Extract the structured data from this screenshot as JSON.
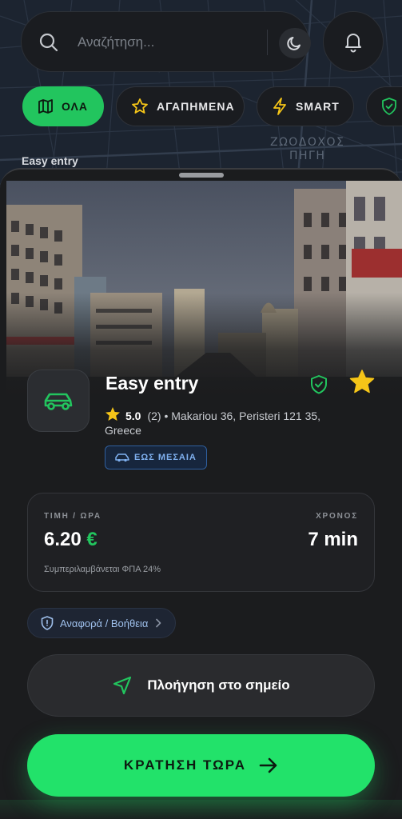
{
  "search": {
    "placeholder": "Αναζήτηση..."
  },
  "map": {
    "district_label_line1": "ΖΩΟΔΟΧΟΣ",
    "district_label_line2": "ΠΗΓΗ"
  },
  "filters": [
    {
      "label": "ΟΛΑ",
      "icon": "map-icon",
      "active": true
    },
    {
      "label": "ΑΓΑΠΗΜΕΝΑ",
      "icon": "star-outline-icon",
      "active": false
    },
    {
      "label": "SMART",
      "icon": "lightning-icon",
      "active": false
    }
  ],
  "map_pin_label": "Easy entry",
  "spot": {
    "title": "Easy entry",
    "rating": "5.0",
    "reviews_and_address": "(2) • Makariou 36, Peristeri 121 35, Greece",
    "size_badge": "ΕΩΣ ΜΕΣΑΙΑ"
  },
  "price_card": {
    "price_label": "ΤΙΜΗ / ΩΡΑ",
    "price_value": "6.20",
    "currency": "€",
    "time_label": "ΧΡΟΝΟΣ",
    "time_value": "7 min",
    "vat_note": "Συμπεριλαμβάνεται ΦΠΑ 24%"
  },
  "actions": {
    "report_label": "Αναφορά / Βοήθεια",
    "navigate_label": "Πλοήγηση στο σημείο",
    "book_label": "ΚΡΑΤΗΣΗ ΤΩΡΑ"
  },
  "colors": {
    "accent": "#22c55e",
    "button_green": "#22e26a",
    "star": "#f5c518",
    "badge_blue": "#7fb0ef"
  }
}
